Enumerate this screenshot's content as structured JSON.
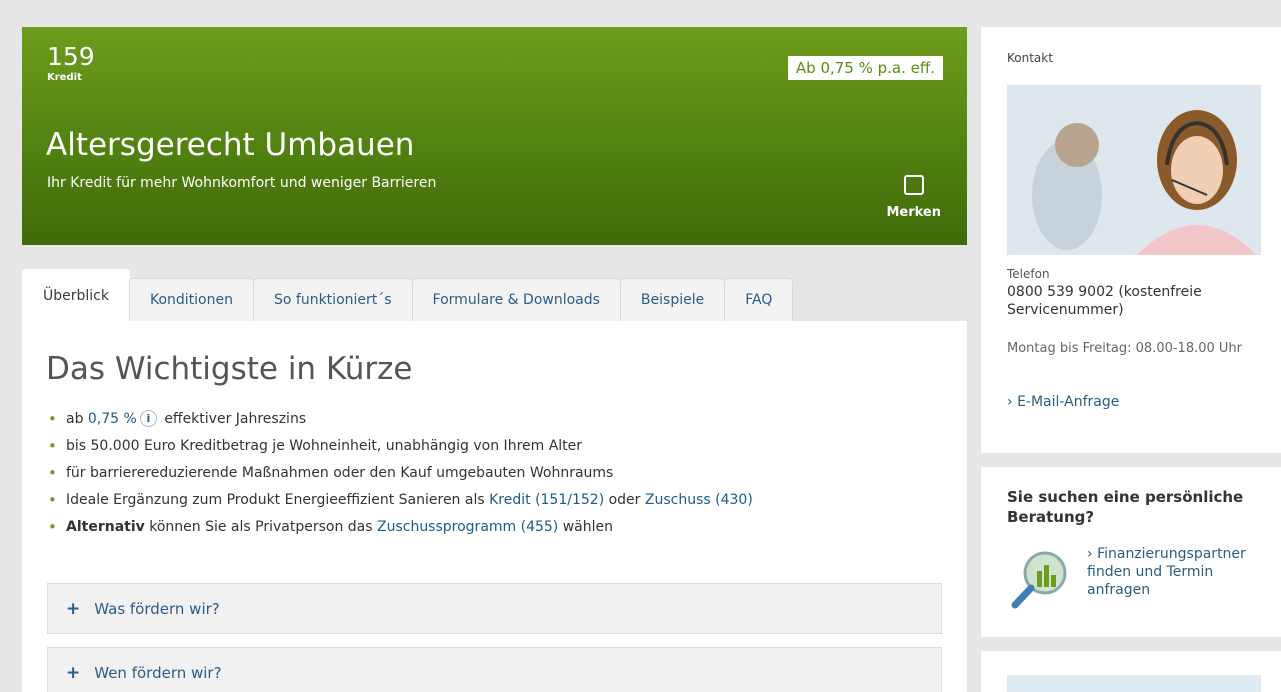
{
  "hero": {
    "number": "159",
    "type": "Kredit",
    "rate": "Ab 0,75 % p.a. eff.",
    "title": "Altersgerecht Umbauen",
    "subtitle": "Ihr Kredit für mehr Wohnkomfort und weniger Barrieren",
    "merken": "Merken"
  },
  "tabs": [
    "Überblick",
    "Konditionen",
    "So funktioniert´s",
    "Formulare & Downloads",
    "Beispiele",
    "FAQ"
  ],
  "main": {
    "heading": "Das Wichtigste in Kürze",
    "bullet1": {
      "pre": "ab",
      "link": "0,75 %",
      "info": "i",
      "post": "effektiver Jahreszins"
    },
    "bullet2": "bis 50.000 Euro Kreditbetrag je Wohneinheit, unabhängig von Ihrem Alter",
    "bullet3": "für barrierereduzierende Maßnahmen oder den Kauf umgebauten Wohnraums",
    "bullet4": {
      "pre": "Ideale Ergänzung zum Produkt Energieeffizient Sanieren als",
      "link1": "Kredit (151/152)",
      "mid": "oder",
      "link2": "Zuschuss (430)"
    },
    "bullet5": {
      "bold": "Alternativ",
      "pre": "können Sie als Privatperson das",
      "link": "Zuschussprogramm (455)",
      "post": "wählen"
    },
    "accordion": [
      "Was fördern wir?",
      "Wen fördern wir?"
    ],
    "plus": "+"
  },
  "sidebar": {
    "contact_heading": "Kontakt",
    "phone_label": "Telefon",
    "phone_number": "0800 539 9002 (kostenfreie Servicenummer)",
    "hours": "Montag bis Freitag: 08.00-18.00 Uhr",
    "email_link": "E-Mail-Anfrage",
    "advice_heading": "Sie suchen eine persönliche Beratung?",
    "advice_link": "Finanzierungspartner finden und Termin anfragen",
    "chevron": "›"
  },
  "colors": {
    "hero_green": "#5a8c13",
    "link_blue": "#2c5b86"
  }
}
